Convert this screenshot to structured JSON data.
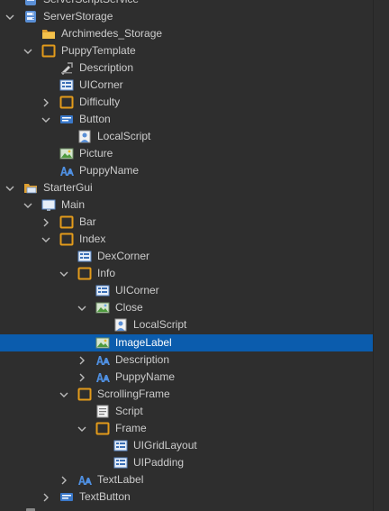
{
  "explorer": {
    "accent_color": "#0b5cad",
    "items": [
      {
        "label": "ServerScriptService",
        "icon": "server-script-service-icon",
        "chevron": "none"
      },
      {
        "label": "ServerStorage",
        "icon": "server-storage-icon",
        "chevron": "expanded"
      },
      {
        "label": "Archimedes_Storage",
        "icon": "folder-icon",
        "chevron": "none"
      },
      {
        "label": "PuppyTemplate",
        "icon": "frame-icon",
        "chevron": "expanded"
      },
      {
        "label": "Description",
        "icon": "description-icon",
        "chevron": "none"
      },
      {
        "label": "UICorner",
        "icon": "ui-component-icon",
        "chevron": "none"
      },
      {
        "label": "Difficulty",
        "icon": "frame-icon",
        "chevron": "collapsed"
      },
      {
        "label": "Button",
        "icon": "text-button-icon",
        "chevron": "expanded"
      },
      {
        "label": "LocalScript",
        "icon": "local-script-icon",
        "chevron": "none"
      },
      {
        "label": "Picture",
        "icon": "image-label-icon",
        "chevron": "none"
      },
      {
        "label": "PuppyName",
        "icon": "text-label-icon",
        "chevron": "none"
      },
      {
        "label": "StarterGui",
        "icon": "starter-gui-icon",
        "chevron": "expanded"
      },
      {
        "label": "Main",
        "icon": "screen-gui-icon",
        "chevron": "expanded"
      },
      {
        "label": "Bar",
        "icon": "frame-icon",
        "chevron": "collapsed"
      },
      {
        "label": "Index",
        "icon": "frame-icon",
        "chevron": "expanded"
      },
      {
        "label": "DexCorner",
        "icon": "ui-component-icon",
        "chevron": "none"
      },
      {
        "label": "Info",
        "icon": "frame-icon",
        "chevron": "expanded"
      },
      {
        "label": "UICorner",
        "icon": "ui-component-icon",
        "chevron": "none"
      },
      {
        "label": "Close",
        "icon": "image-button-icon",
        "chevron": "expanded"
      },
      {
        "label": "LocalScript",
        "icon": "local-script-icon",
        "chevron": "none"
      },
      {
        "label": "ImageLabel",
        "icon": "image-label-icon",
        "chevron": "none",
        "selected": true
      },
      {
        "label": "Description",
        "icon": "text-label-icon",
        "chevron": "collapsed"
      },
      {
        "label": "PuppyName",
        "icon": "text-label-icon",
        "chevron": "collapsed"
      },
      {
        "label": "ScrollingFrame",
        "icon": "frame-icon",
        "chevron": "expanded"
      },
      {
        "label": "Script",
        "icon": "script-icon",
        "chevron": "none"
      },
      {
        "label": "Frame",
        "icon": "frame-icon",
        "chevron": "expanded"
      },
      {
        "label": "UIGridLayout",
        "icon": "ui-component-icon",
        "chevron": "none"
      },
      {
        "label": "UIPadding",
        "icon": "ui-component-icon",
        "chevron": "none"
      },
      {
        "label": "TextLabel",
        "icon": "text-label-icon",
        "chevron": "collapsed"
      },
      {
        "label": "TextButton",
        "icon": "text-button-icon",
        "chevron": "collapsed"
      }
    ]
  }
}
